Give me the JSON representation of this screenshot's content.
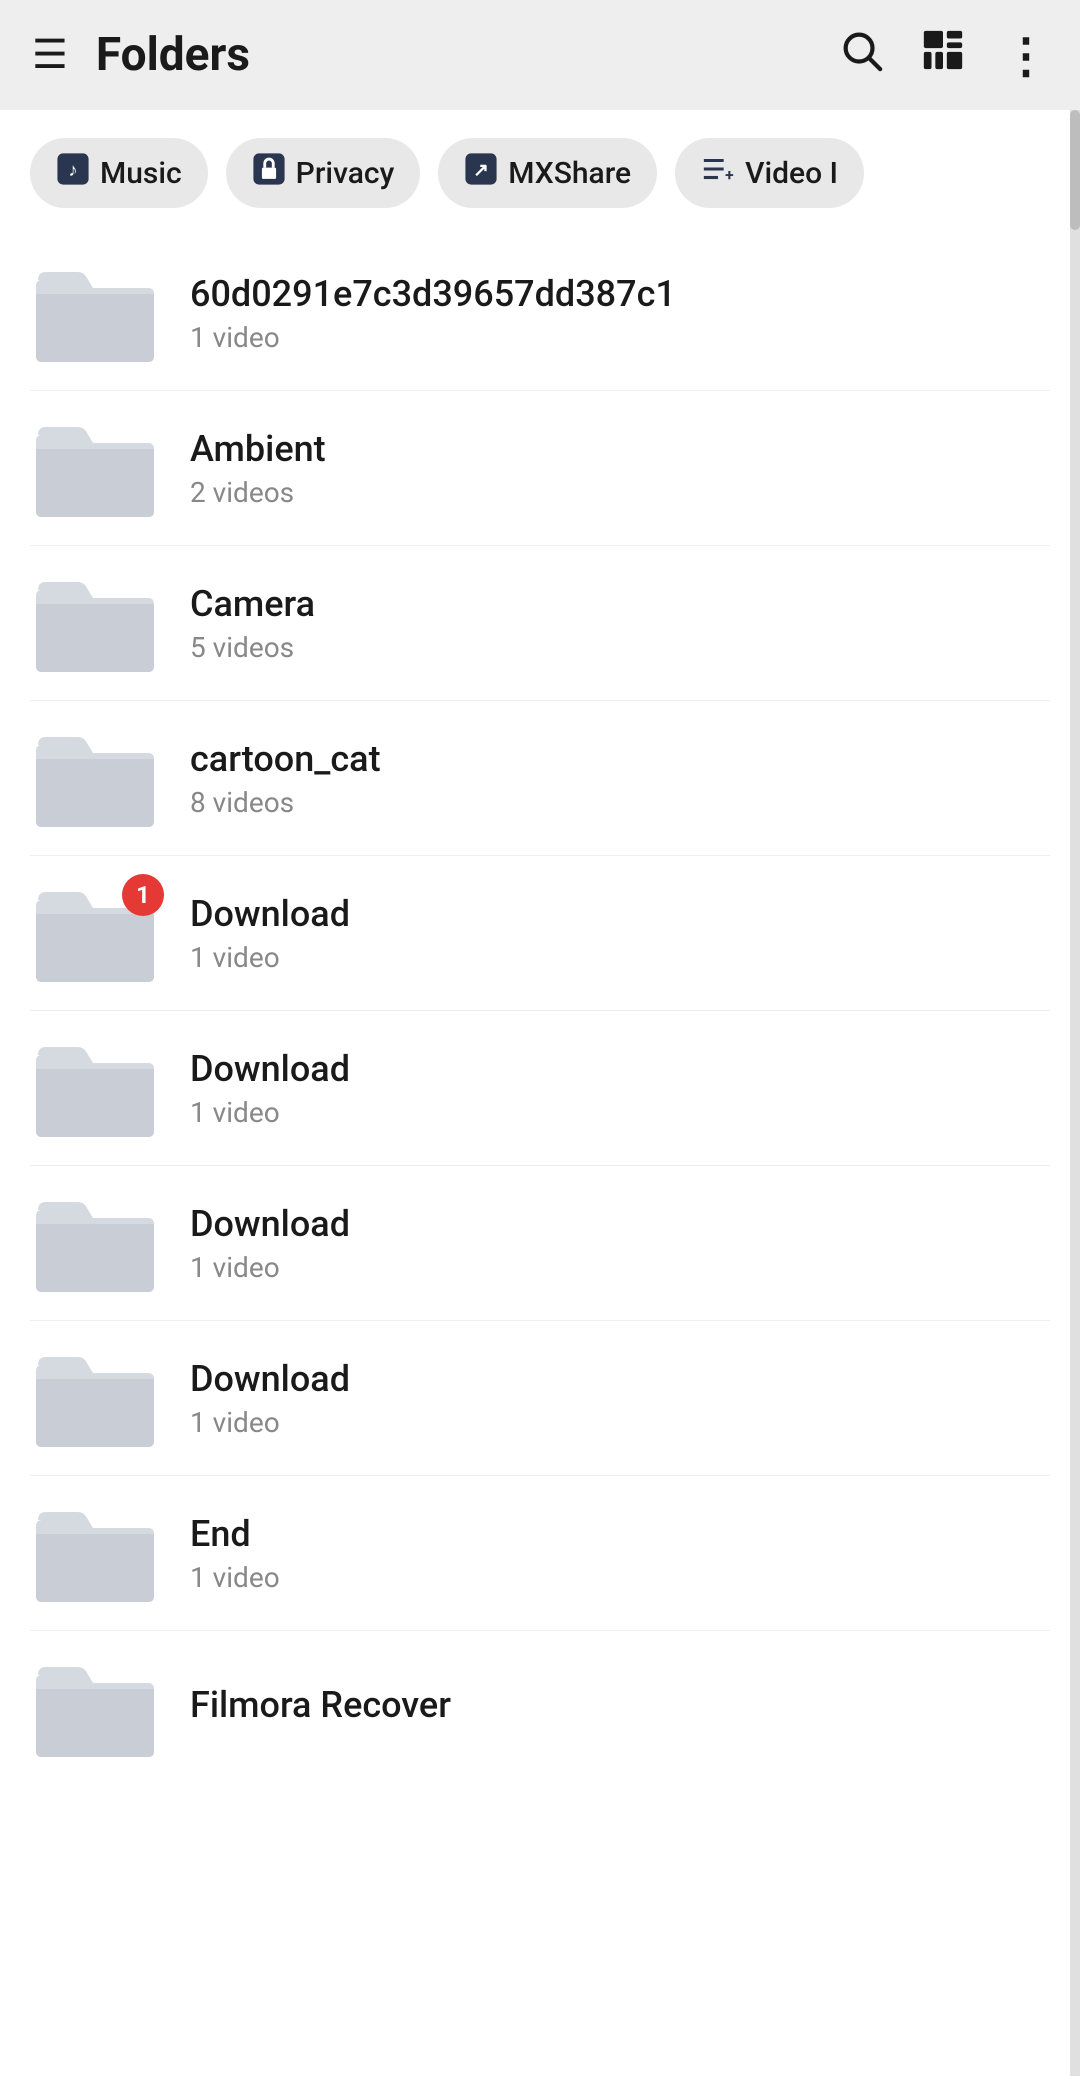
{
  "header": {
    "title": "Folders",
    "menu_icon": "≡",
    "search_icon": "🔍",
    "grid_icon": "▦",
    "more_icon": "⋮"
  },
  "chips": [
    {
      "id": "music",
      "label": "Music",
      "icon": "♪"
    },
    {
      "id": "privacy",
      "label": "Privacy",
      "icon": "🔒"
    },
    {
      "id": "mxshare",
      "label": "MXShare",
      "icon": "↗"
    },
    {
      "id": "video-import",
      "label": "Video I",
      "icon": "≡+"
    }
  ],
  "folders": [
    {
      "id": "folder-hex",
      "name": "60d0291e7c3d39657dd387c1",
      "count": "1 video",
      "badge": null
    },
    {
      "id": "folder-ambient",
      "name": "Ambient",
      "count": "2 videos",
      "badge": null
    },
    {
      "id": "folder-camera",
      "name": "Camera",
      "count": "5 videos",
      "badge": null
    },
    {
      "id": "folder-cartoon",
      "name": "cartoon_cat",
      "count": "8 videos",
      "badge": null
    },
    {
      "id": "folder-download1",
      "name": "Download",
      "count": "1 video",
      "badge": "1"
    },
    {
      "id": "folder-download2",
      "name": "Download",
      "count": "1 video",
      "badge": null
    },
    {
      "id": "folder-download3",
      "name": "Download",
      "count": "1 video",
      "badge": null
    },
    {
      "id": "folder-download4",
      "name": "Download",
      "count": "1 video",
      "badge": null
    },
    {
      "id": "folder-end",
      "name": "End",
      "count": "1 video",
      "badge": null
    },
    {
      "id": "folder-filmora",
      "name": "Filmora Recover",
      "count": "",
      "badge": null
    }
  ]
}
